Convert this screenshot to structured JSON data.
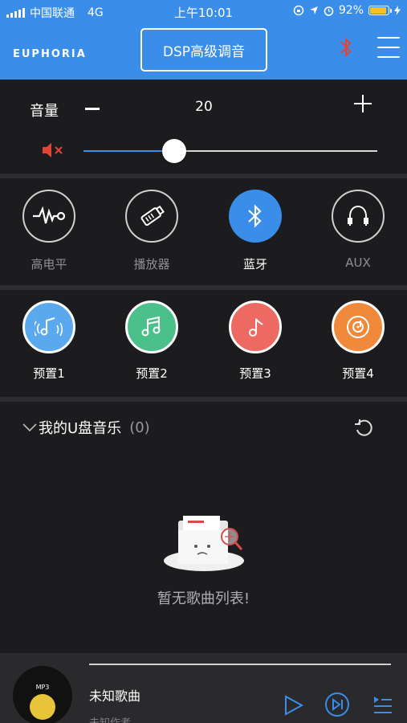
{
  "status": {
    "carrier": "中国联通",
    "network": "4G",
    "time": "上午10:01",
    "battery_text": "92%",
    "battery_level": 0.92
  },
  "header": {
    "brand": "EUPHORIA",
    "dsp_button": "DSP高级调音",
    "accent_color": "#3a8de8",
    "bluetooth_icon_color": "#e0453a"
  },
  "volume": {
    "label": "音量",
    "value": "20",
    "level": 0.31
  },
  "sources": [
    {
      "label": "高电平",
      "icon": "high-level-icon",
      "active": false
    },
    {
      "label": "播放器",
      "icon": "usb-drive-icon",
      "active": false
    },
    {
      "label": "蓝牙",
      "icon": "bluetooth-icon",
      "active": true
    },
    {
      "label": "AUX",
      "icon": "aux-cable-icon",
      "active": false
    }
  ],
  "presets": [
    {
      "label": "预置1",
      "icon": "music-wave-icon",
      "color": "#5aa9ef"
    },
    {
      "label": "预置2",
      "icon": "music-notes-icon",
      "color": "#4cc08a"
    },
    {
      "label": "预置3",
      "icon": "music-note-icon",
      "color": "#ec6a61"
    },
    {
      "label": "预置4",
      "icon": "music-disc-icon",
      "color": "#f0893a"
    }
  ],
  "usb": {
    "title": "我的U盘音乐",
    "count": "(0)",
    "empty_text": "暂无歌曲列表!"
  },
  "player": {
    "badge": "MP3",
    "song": "未知歌曲",
    "artist": "未知作者"
  }
}
